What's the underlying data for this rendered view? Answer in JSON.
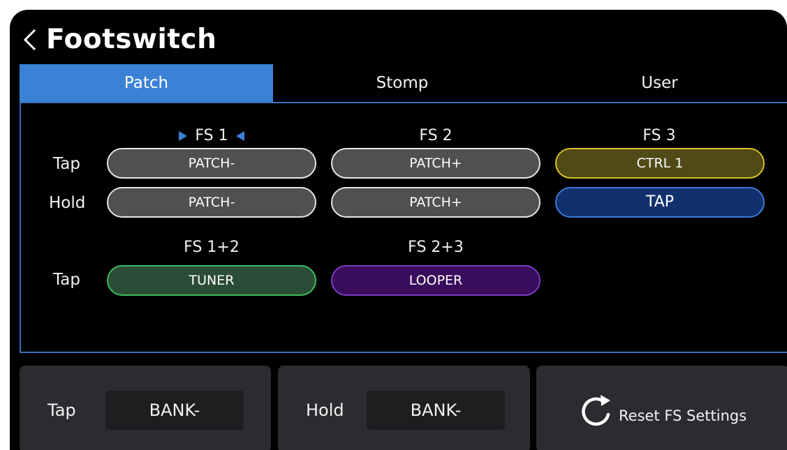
{
  "header": {
    "title": "Footswitch",
    "back_icon": "chevron-left-icon"
  },
  "tabs": [
    {
      "label": "Patch",
      "active": true
    },
    {
      "label": "Stomp",
      "active": false
    },
    {
      "label": "User",
      "active": false
    }
  ],
  "colors": {
    "accent": "#3b82d6",
    "ctrl_yellow": "#d9c12a",
    "tap_blue": "#3d7ad8",
    "tuner_green": "#3dbc5e",
    "looper_purple": "#7a3cc0"
  },
  "grid": {
    "rows": {
      "tap": "Tap",
      "hold": "Hold"
    },
    "fs1": {
      "label": "FS 1",
      "selected": true,
      "tap": "PATCH-",
      "hold": "PATCH-"
    },
    "fs2": {
      "label": "FS 2",
      "tap": "PATCH+",
      "hold": "PATCH+"
    },
    "fs3": {
      "label": "FS 3",
      "tap": "CTRL 1",
      "hold": "TAP"
    },
    "fs12": {
      "label": "FS 1+2",
      "tap": "TUNER"
    },
    "fs23": {
      "label": "FS 2+3",
      "tap": "LOOPER"
    }
  },
  "bottom": {
    "tap": {
      "label": "Tap",
      "value": "BANK-"
    },
    "hold": {
      "label": "Hold",
      "value": "BANK-"
    },
    "reset": {
      "label": "Reset FS Settings",
      "icon": "reset-icon"
    }
  }
}
